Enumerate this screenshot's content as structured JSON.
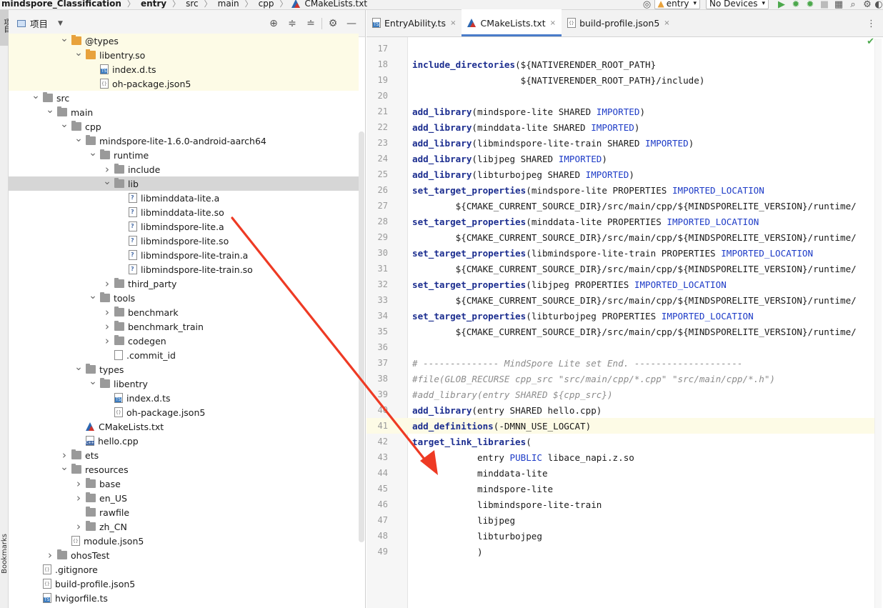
{
  "navbar": {
    "breadcrumbs": [
      "mindspore_Classification",
      "entry",
      "src",
      "main",
      "cpp",
      "CMakeLists.txt"
    ],
    "run_config": "entry",
    "device": "No Devices"
  },
  "left_strip": {
    "project_tab": "项目",
    "bookmarks_tab": "Bookmarks"
  },
  "project_panel": {
    "title": "项目",
    "tree": [
      {
        "label": "@types",
        "depth": 4,
        "chevron": "down",
        "icon": "folder-orange",
        "hl": true
      },
      {
        "label": "libentry.so",
        "depth": 5,
        "chevron": "down",
        "icon": "folder-orange",
        "hl": true
      },
      {
        "label": "index.d.ts",
        "depth": 6,
        "chevron": "",
        "icon": "file-ts",
        "hl": true
      },
      {
        "label": "oh-package.json5",
        "depth": 6,
        "chevron": "",
        "icon": "file-json",
        "hl": true
      },
      {
        "label": "src",
        "depth": 2,
        "chevron": "down",
        "icon": "folder"
      },
      {
        "label": "main",
        "depth": 3,
        "chevron": "down",
        "icon": "folder"
      },
      {
        "label": "cpp",
        "depth": 4,
        "chevron": "down",
        "icon": "folder"
      },
      {
        "label": "mindspore-lite-1.6.0-android-aarch64",
        "depth": 5,
        "chevron": "down",
        "icon": "folder"
      },
      {
        "label": "runtime",
        "depth": 6,
        "chevron": "down",
        "icon": "folder"
      },
      {
        "label": "include",
        "depth": 7,
        "chevron": "right",
        "icon": "folder"
      },
      {
        "label": "lib",
        "depth": 7,
        "chevron": "down",
        "icon": "folder",
        "sel": true
      },
      {
        "label": "libminddata-lite.a",
        "depth": 8,
        "chevron": "",
        "icon": "file-lib"
      },
      {
        "label": "libminddata-lite.so",
        "depth": 8,
        "chevron": "",
        "icon": "file-lib"
      },
      {
        "label": "libmindspore-lite.a",
        "depth": 8,
        "chevron": "",
        "icon": "file-lib"
      },
      {
        "label": "libmindspore-lite.so",
        "depth": 8,
        "chevron": "",
        "icon": "file-lib"
      },
      {
        "label": "libmindspore-lite-train.a",
        "depth": 8,
        "chevron": "",
        "icon": "file-lib"
      },
      {
        "label": "libmindspore-lite-train.so",
        "depth": 8,
        "chevron": "",
        "icon": "file-lib"
      },
      {
        "label": "third_party",
        "depth": 7,
        "chevron": "right",
        "icon": "folder"
      },
      {
        "label": "tools",
        "depth": 6,
        "chevron": "down",
        "icon": "folder"
      },
      {
        "label": "benchmark",
        "depth": 7,
        "chevron": "right",
        "icon": "folder"
      },
      {
        "label": "benchmark_train",
        "depth": 7,
        "chevron": "right",
        "icon": "folder"
      },
      {
        "label": "codegen",
        "depth": 7,
        "chevron": "right",
        "icon": "folder"
      },
      {
        "label": ".commit_id",
        "depth": 7,
        "chevron": "",
        "icon": "file-plain"
      },
      {
        "label": "types",
        "depth": 5,
        "chevron": "down",
        "icon": "folder"
      },
      {
        "label": "libentry",
        "depth": 6,
        "chevron": "down",
        "icon": "folder"
      },
      {
        "label": "index.d.ts",
        "depth": 7,
        "chevron": "",
        "icon": "file-ts"
      },
      {
        "label": "oh-package.json5",
        "depth": 7,
        "chevron": "",
        "icon": "file-json"
      },
      {
        "label": "CMakeLists.txt",
        "depth": 5,
        "chevron": "",
        "icon": "cmake"
      },
      {
        "label": "hello.cpp",
        "depth": 5,
        "chevron": "",
        "icon": "file-cpp"
      },
      {
        "label": "ets",
        "depth": 4,
        "chevron": "right",
        "icon": "folder"
      },
      {
        "label": "resources",
        "depth": 4,
        "chevron": "down",
        "icon": "folder"
      },
      {
        "label": "base",
        "depth": 5,
        "chevron": "right",
        "icon": "folder"
      },
      {
        "label": "en_US",
        "depth": 5,
        "chevron": "right",
        "icon": "folder"
      },
      {
        "label": "rawfile",
        "depth": 5,
        "chevron": "",
        "icon": "folder"
      },
      {
        "label": "zh_CN",
        "depth": 5,
        "chevron": "right",
        "icon": "folder"
      },
      {
        "label": "module.json5",
        "depth": 4,
        "chevron": "",
        "icon": "file-json"
      },
      {
        "label": "ohosTest",
        "depth": 3,
        "chevron": "right",
        "icon": "folder"
      },
      {
        "label": ".gitignore",
        "depth": 2,
        "chevron": "",
        "icon": "file-json"
      },
      {
        "label": "build-profile.json5",
        "depth": 2,
        "chevron": "",
        "icon": "file-json"
      },
      {
        "label": "hvigorfile.ts",
        "depth": 2,
        "chevron": "",
        "icon": "file-ts"
      }
    ]
  },
  "editor": {
    "tabs": [
      {
        "label": "EntryAbility.ts",
        "icon": "file-ts",
        "active": false
      },
      {
        "label": "CMakeLists.txt",
        "icon": "cmake",
        "active": true
      },
      {
        "label": "build-profile.json5",
        "icon": "file-json",
        "active": false
      }
    ],
    "lines": [
      {
        "n": "17",
        "html": ""
      },
      {
        "n": "18",
        "html": "<span class=\"kw\">include_directories</span>(${NATIVERENDER_ROOT_PATH}"
      },
      {
        "n": "19",
        "html": "                    ${NATIVERENDER_ROOT_PATH}/include)"
      },
      {
        "n": "20",
        "html": ""
      },
      {
        "n": "21",
        "html": "<span class=\"kw\">add_library</span>(mindspore-lite SHARED <span class=\"kw2\">IMPORTED</span>)"
      },
      {
        "n": "22",
        "html": "<span class=\"kw\">add_library</span>(minddata-lite SHARED <span class=\"kw2\">IMPORTED</span>)"
      },
      {
        "n": "23",
        "html": "<span class=\"kw\">add_library</span>(libmindspore-lite-train SHARED <span class=\"kw2\">IMPORTED</span>)"
      },
      {
        "n": "24",
        "html": "<span class=\"kw\">add_library</span>(libjpeg SHARED <span class=\"kw2\">IMPORTED</span>)"
      },
      {
        "n": "25",
        "html": "<span class=\"kw\">add_library</span>(libturbojpeg SHARED <span class=\"kw2\">IMPORTED</span>)"
      },
      {
        "n": "26",
        "html": "<span class=\"kw\">set_target_properties</span>(mindspore-lite PROPERTIES <span class=\"kw2\">IMPORTED_LOCATION</span>"
      },
      {
        "n": "27",
        "html": "        ${CMAKE_CURRENT_SOURCE_DIR}/src/main/cpp/${MINDSPORELITE_VERSION}/runtime/"
      },
      {
        "n": "28",
        "html": "<span class=\"kw\">set_target_properties</span>(minddata-lite PROPERTIES <span class=\"kw2\">IMPORTED_LOCATION</span>"
      },
      {
        "n": "29",
        "html": "        ${CMAKE_CURRENT_SOURCE_DIR}/src/main/cpp/${MINDSPORELITE_VERSION}/runtime/"
      },
      {
        "n": "30",
        "html": "<span class=\"kw\">set_target_properties</span>(libmindspore-lite-train PROPERTIES <span class=\"kw2\">IMPORTED_LOCATION</span>"
      },
      {
        "n": "31",
        "html": "        ${CMAKE_CURRENT_SOURCE_DIR}/src/main/cpp/${MINDSPORELITE_VERSION}/runtime/"
      },
      {
        "n": "32",
        "html": "<span class=\"kw\">set_target_properties</span>(libjpeg PROPERTIES <span class=\"kw2\">IMPORTED_LOCATION</span>"
      },
      {
        "n": "33",
        "html": "        ${CMAKE_CURRENT_SOURCE_DIR}/src/main/cpp/${MINDSPORELITE_VERSION}/runtime/"
      },
      {
        "n": "34",
        "html": "<span class=\"kw\">set_target_properties</span>(libturbojpeg PROPERTIES <span class=\"kw2\">IMPORTED_LOCATION</span>"
      },
      {
        "n": "35",
        "html": "        ${CMAKE_CURRENT_SOURCE_DIR}/src/main/cpp/${MINDSPORELITE_VERSION}/runtime/"
      },
      {
        "n": "36",
        "html": ""
      },
      {
        "n": "37",
        "html": "<span class=\"cm\"># -------------- MindSpore Lite set End. --------------------</span>"
      },
      {
        "n": "38",
        "html": "<span class=\"cm\">#file(GLOB_RECURSE cpp_src \"src/main/cpp/*.cpp\" \"src/main/cpp/*.h\")</span>"
      },
      {
        "n": "39",
        "html": "<span class=\"cm\">#add_library(entry SHARED ${cpp_src})</span>"
      },
      {
        "n": "40",
        "html": "<span class=\"kw\">add_library</span>(entry SHARED hello.cpp)"
      },
      {
        "n": "41",
        "html": "<span class=\"kw\">add_definitions</span>(-DMNN_USE_LOGCAT)",
        "current": true
      },
      {
        "n": "42",
        "html": "<span class=\"kw\">target_link_libraries</span>("
      },
      {
        "n": "43",
        "html": "            entry <span class=\"kw2\">PUBLIC</span> libace_napi.z.so"
      },
      {
        "n": "44",
        "html": "            minddata-lite"
      },
      {
        "n": "45",
        "html": "            mindspore-lite"
      },
      {
        "n": "46",
        "html": "            libmindspore-lite-train"
      },
      {
        "n": "47",
        "html": "            libjpeg"
      },
      {
        "n": "48",
        "html": "            libturbojpeg"
      },
      {
        "n": "49",
        "html": "            )"
      }
    ]
  },
  "colors": {
    "accent": "#4a7cc9",
    "keyword": "#1b2d8f",
    "arrow": "#ee3a24",
    "highlight_row": "#fdfbe6"
  }
}
